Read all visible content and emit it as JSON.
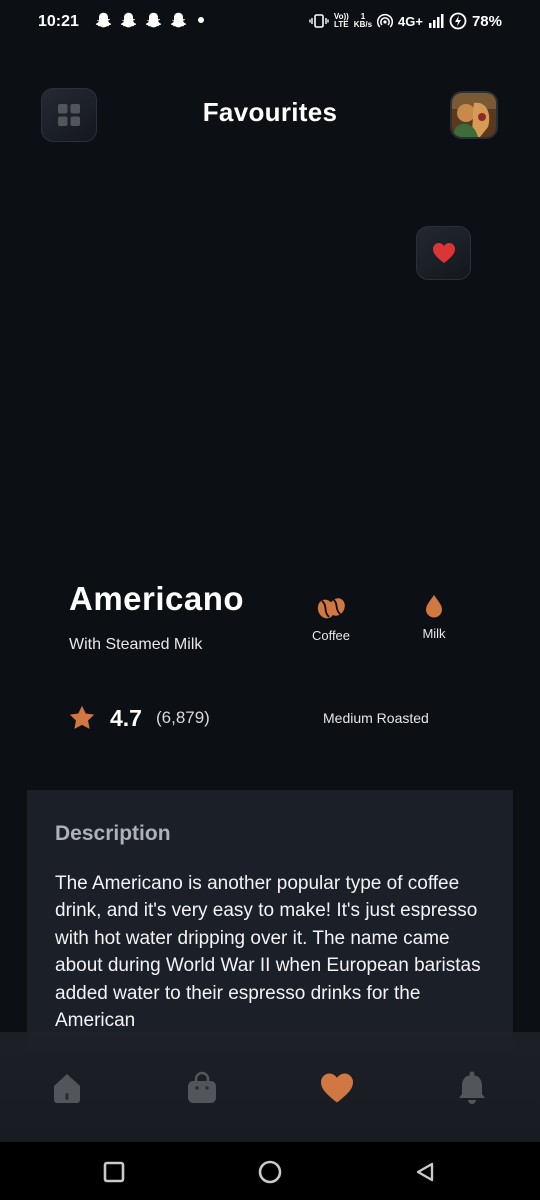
{
  "status_bar": {
    "time": "10:21",
    "network_volte_top": "Vo))",
    "network_volte_bottom": "LTE",
    "speed_value": "1",
    "speed_unit": "KB/s",
    "network_type": "4G+",
    "battery_percent": "78%",
    "notification_icons": [
      "snapchat-icon",
      "snapchat-icon",
      "snapchat-icon",
      "snapchat-icon"
    ]
  },
  "header": {
    "title": "Favourites",
    "menu_icon": "grid-icon",
    "avatar_icon": "avatar"
  },
  "product": {
    "name": "Americano",
    "subtitle": "With Steamed Milk",
    "chips": [
      {
        "label": "Coffee",
        "icon": "coffee-bean-icon"
      },
      {
        "label": "Milk",
        "icon": "milk-drop-icon"
      }
    ],
    "rating": "4.7",
    "rating_count": "(6,879)",
    "roast": "Medium Roasted",
    "favourite": true
  },
  "description": {
    "title": "Description",
    "text": "The Americano is another popular type of coffee drink, and it's very easy to make! It's just espresso with hot water dripping over it. The name came about during World War II when European baristas added water to their espresso drinks for the American"
  },
  "bottom_nav": {
    "items": [
      {
        "icon": "home-icon",
        "active": false
      },
      {
        "icon": "bag-icon",
        "active": false
      },
      {
        "icon": "heart-icon",
        "active": true
      },
      {
        "icon": "bell-icon",
        "active": false
      }
    ]
  },
  "colors": {
    "background": "#0c0f14",
    "accent": "#d17842",
    "favourite_red": "#dc3535",
    "inactive_icon": "#52555a"
  }
}
